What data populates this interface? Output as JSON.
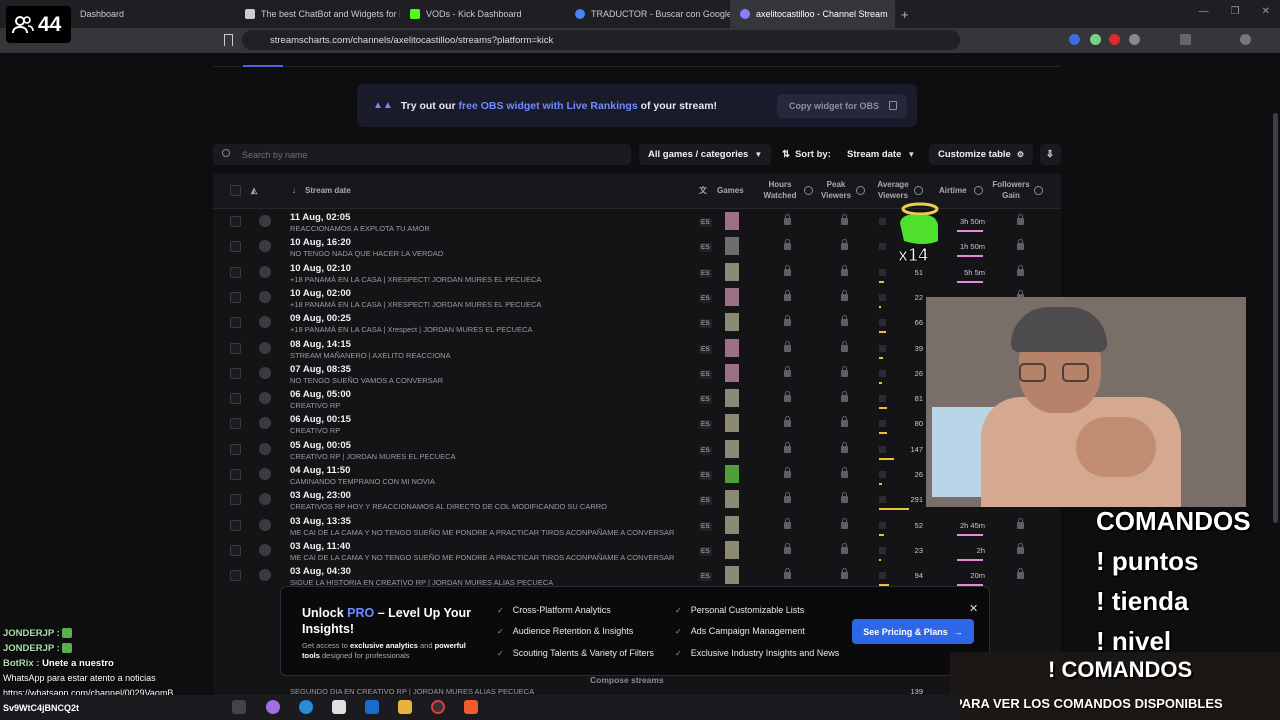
{
  "overlay": {
    "viewer_count": "44",
    "commands": [
      "COMANDOS",
      "! puntos",
      "! tienda",
      "! nivel"
    ],
    "commands_box_title": "! COMANDOS",
    "commands_box_sub": "PARA VER LOS COMANDOS DISPONIBLES",
    "mascot_multiplier": "x14"
  },
  "browser": {
    "tabs": [
      {
        "label": "Dashboard",
        "color": "#53fc18"
      },
      {
        "label": "The best ChatBot and Widgets for Ki",
        "color": "#cccccc"
      },
      {
        "label": "VODs - Kick Dashboard",
        "color": "#53fc18"
      },
      {
        "label": "TRADUCTOR - Buscar con Google",
        "color": "#4285f4"
      },
      {
        "label": "axelitocastilloo - Channel Stream",
        "color": "#8a7cff"
      }
    ],
    "url": "streamscharts.com/channels/axelitocastilloo/streams?platform=kick"
  },
  "obs_banner": {
    "prefix": "Try out our ",
    "link": "free OBS widget with Live Rankings",
    "suffix": " of your stream!",
    "copy_button": "Copy widget for OBS"
  },
  "filters": {
    "search_placeholder": "Search by name",
    "games_dropdown": "All games / categories",
    "sort_label": "Sort by:",
    "sort_value": "Stream date",
    "customize": "Customize table"
  },
  "table": {
    "headers": {
      "stream_date": "Stream date",
      "games": "Games",
      "hours_watched": "Hours Watched",
      "peak_viewers": "Peak Viewers",
      "avg_viewers": "Average Viewers",
      "airtime": "Airtime",
      "followers_gain": "Followers Gain"
    },
    "rows": [
      {
        "date": "11 Aug, 02:05",
        "title": "REACCIONAMOS A EXPLOTA TU AMOR",
        "lang": "ES",
        "avg": "",
        "airtime": "3h 50m"
      },
      {
        "date": "10 Aug, 16:20",
        "title": "NO TENGO NADA QUE HACER LA VERDAD",
        "lang": "ES",
        "avg": "",
        "airtime": "1h 50m"
      },
      {
        "date": "10 Aug, 02:10",
        "title": "+18 PANAMÁ EN LA CASA | XRESPECT! JORDAN MURES EL PECUECA",
        "lang": "ES",
        "avg": "51",
        "airtime": "5h 5m"
      },
      {
        "date": "10 Aug, 02:00",
        "title": "+18 PANAMÁ EN LA CASA | XRESPECT! JORDAN MURES EL PECUECA",
        "lang": "ES",
        "avg": "22",
        "airtime": ""
      },
      {
        "date": "09 Aug, 00:25",
        "title": "+18 PANAMÁ EN LA CASA | Xrespect | JORDAN MURES EL PECUECA",
        "lang": "ES",
        "avg": "66",
        "airtime": ""
      },
      {
        "date": "08 Aug, 14:15",
        "title": "STREAM MAÑANERO | AXELITO REACCIONA",
        "lang": "ES",
        "avg": "39",
        "airtime": ""
      },
      {
        "date": "07 Aug, 08:35",
        "title": "NO TENGO SUEÑO VAMOS A CONVERSAR",
        "lang": "ES",
        "avg": "26",
        "airtime": ""
      },
      {
        "date": "06 Aug, 05:00",
        "title": "CREATIVO RP",
        "lang": "ES",
        "avg": "81",
        "airtime": ""
      },
      {
        "date": "06 Aug, 00:15",
        "title": "CREATIVO RP",
        "lang": "ES",
        "avg": "80",
        "airtime": ""
      },
      {
        "date": "05 Aug, 00:05",
        "title": "CREATIVO RP | JORDAN MURES EL PECUECA",
        "lang": "ES",
        "avg": "147",
        "airtime": ""
      },
      {
        "date": "04 Aug, 11:50",
        "title": "CAMINANDO TEMPRANO CON MI NOVIA",
        "lang": "ES",
        "avg": "26",
        "airtime": ""
      },
      {
        "date": "03 Aug, 23:00",
        "title": "CREATIVOS RP HOY Y REACCIONAMOS AL DIRECTO DE COL MODIFICANDO SU CARRO",
        "lang": "ES",
        "avg": "291",
        "airtime": ""
      },
      {
        "date": "03 Aug, 13:35",
        "title": "ME CAI DE LA CAMA Y NO TENGO SUEÑO ME PONDRE A PRACTICAR TIROS ACONPAÑAME A CONVERSAR",
        "lang": "ES",
        "avg": "52",
        "airtime": "2h 45m"
      },
      {
        "date": "03 Aug, 11:40",
        "title": "ME CAI DE LA CAMA Y NO TENGO SUEÑO ME PONDRE A PRACTICAR TIROS ACONPAÑAME A CONVERSAR",
        "lang": "ES",
        "avg": "23",
        "airtime": "2h"
      },
      {
        "date": "03 Aug, 04:30",
        "title": "SIGUE LA HISTORIA EN CREATIVO RP | JORDAN MURES ALIAS PECUECA",
        "lang": "ES",
        "avg": "94",
        "airtime": "20m"
      }
    ],
    "last_row_title": "SEGUNDO DIA EN CREATIVO RP | JORDAN MURES ALIAS PECUECA",
    "last_row_avg": "139"
  },
  "promo": {
    "title_pre": "Unlock ",
    "title_pro": "PRO",
    "title_post": " – Level Up Your Insights!",
    "sub_pre": "Get access to ",
    "sub_b1": "exclusive analytics",
    "sub_mid": " and ",
    "sub_b2": "powerful tools",
    "sub_post": " designed for professionals",
    "features": [
      "Cross-Platform Analytics",
      "Audience Retention & Insights",
      "Scouting Talents & Variety of Filters",
      "Personal Customizable Lists",
      "Ads Campaign Management",
      "Exclusive Industry Insights and News"
    ],
    "cta": "See Pricing & Plans",
    "compose": "Compose streams"
  },
  "chat": [
    {
      "user": "JONDERJP :",
      "msg": ""
    },
    {
      "user": "JONDERJP :",
      "msg": ""
    },
    {
      "user": "BotRix :",
      "msg": "Unete a nuestro"
    },
    {
      "user": "",
      "msg": "WhatsApp para estar atento a noticias"
    },
    {
      "user": "",
      "msg": "https://whatsapp.com/channel/0029VaomB"
    },
    {
      "user": "",
      "msg": "Sv9WtC4jBNCQ2t"
    }
  ]
}
